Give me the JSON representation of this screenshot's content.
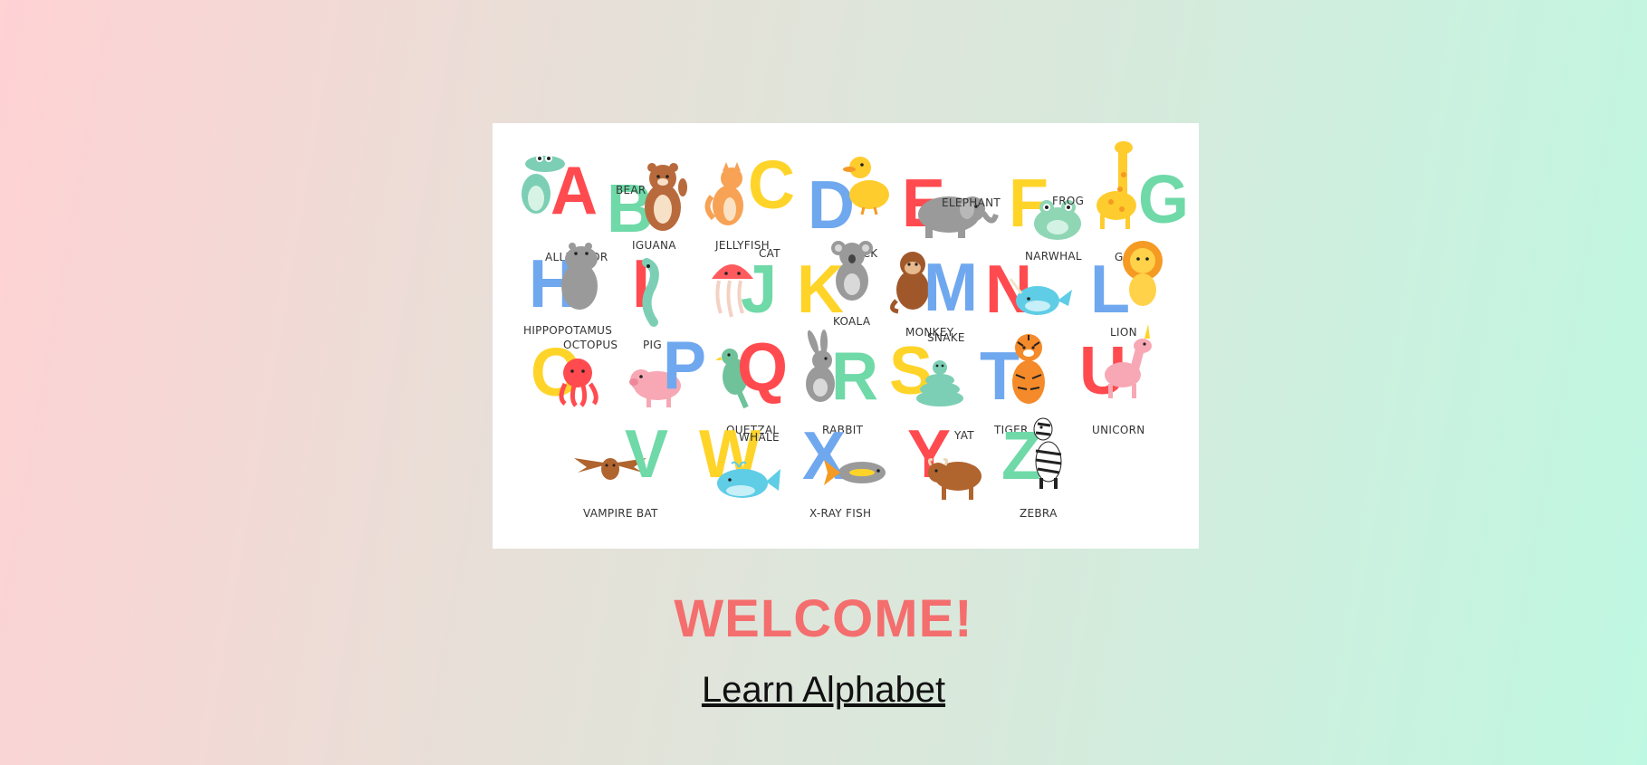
{
  "page": {
    "heading": "WELCOME!",
    "link_label": "Learn Alphabet"
  },
  "colors": {
    "heading": "#f46e6e",
    "red": "#ff4b4f",
    "green": "#6fd9a8",
    "yellow": "#ffd429",
    "blue": "#6fa8ee"
  },
  "poster": {
    "cards": [
      {
        "letter": "A",
        "animal": "ALLIGATOR",
        "icon": "alligator-icon",
        "letter_color": "#ff4b4f"
      },
      {
        "letter": "B",
        "animal": "BEAR",
        "icon": "bear-icon",
        "letter_color": "#6fd9a8"
      },
      {
        "letter": "C",
        "animal": "CAT",
        "icon": "cat-icon",
        "letter_color": "#ffd429"
      },
      {
        "letter": "D",
        "animal": "DUCK",
        "icon": "duck-icon",
        "letter_color": "#6fa8ee"
      },
      {
        "letter": "E",
        "animal": "ELEPHANT",
        "icon": "elephant-icon",
        "letter_color": "#ff4b4f"
      },
      {
        "letter": "F",
        "animal": "FROG",
        "icon": "frog-icon",
        "letter_color": "#ffd429"
      },
      {
        "letter": "G",
        "animal": "GIRAFFE",
        "icon": "giraffe-icon",
        "letter_color": "#6fd9a8"
      },
      {
        "letter": "H",
        "animal": "HIPPOPOTAMUS",
        "icon": "hippopotamus-icon",
        "letter_color": "#6fa8ee"
      },
      {
        "letter": "I",
        "animal": "IGUANA",
        "icon": "iguana-icon",
        "letter_color": "#ff4b4f"
      },
      {
        "letter": "J",
        "animal": "JELLYFISH",
        "icon": "jellyfish-icon",
        "letter_color": "#6fd9a8"
      },
      {
        "letter": "K",
        "animal": "KOALA",
        "icon": "koala-icon",
        "letter_color": "#ffd429"
      },
      {
        "letter": "M",
        "animal": "MONKEY",
        "icon": "monkey-icon",
        "letter_color": "#6fa8ee"
      },
      {
        "letter": "N",
        "animal": "NARWHAL",
        "icon": "narwhal-icon",
        "letter_color": "#ff4b4f"
      },
      {
        "letter": "L",
        "animal": "LION",
        "icon": "lion-icon",
        "letter_color": "#6fa8ee"
      },
      {
        "letter": "O",
        "animal": "OCTOPUS",
        "icon": "octopus-icon",
        "letter_color": "#ffd429"
      },
      {
        "letter": "P",
        "animal": "PIG",
        "icon": "pig-icon",
        "letter_color": "#6fa8ee"
      },
      {
        "letter": "Q",
        "animal": "QUETZAL",
        "icon": "quetzal-icon",
        "letter_color": "#ff4b4f"
      },
      {
        "letter": "R",
        "animal": "RABBIT",
        "icon": "rabbit-icon",
        "letter_color": "#6fd9a8"
      },
      {
        "letter": "S",
        "animal": "SNAKE",
        "icon": "snake-icon",
        "letter_color": "#ffd429"
      },
      {
        "letter": "T",
        "animal": "TIGER",
        "icon": "tiger-icon",
        "letter_color": "#6fa8ee"
      },
      {
        "letter": "U",
        "animal": "UNICORN",
        "icon": "unicorn-icon",
        "letter_color": "#ff4b4f"
      },
      {
        "letter": "V",
        "animal": "VAMPIRE BAT",
        "icon": "vampire-bat-icon",
        "letter_color": "#6fd9a8"
      },
      {
        "letter": "W",
        "animal": "WHALE",
        "icon": "whale-icon",
        "letter_color": "#ffd429"
      },
      {
        "letter": "X",
        "animal": "X-RAY FISH",
        "icon": "x-ray-fish-icon",
        "letter_color": "#6fa8ee"
      },
      {
        "letter": "Y",
        "animal": "YAT",
        "icon": "yak-icon",
        "letter_color": "#ff4b4f"
      },
      {
        "letter": "Z",
        "animal": "ZEBRA",
        "icon": "zebra-icon",
        "letter_color": "#6fd9a8"
      }
    ]
  }
}
